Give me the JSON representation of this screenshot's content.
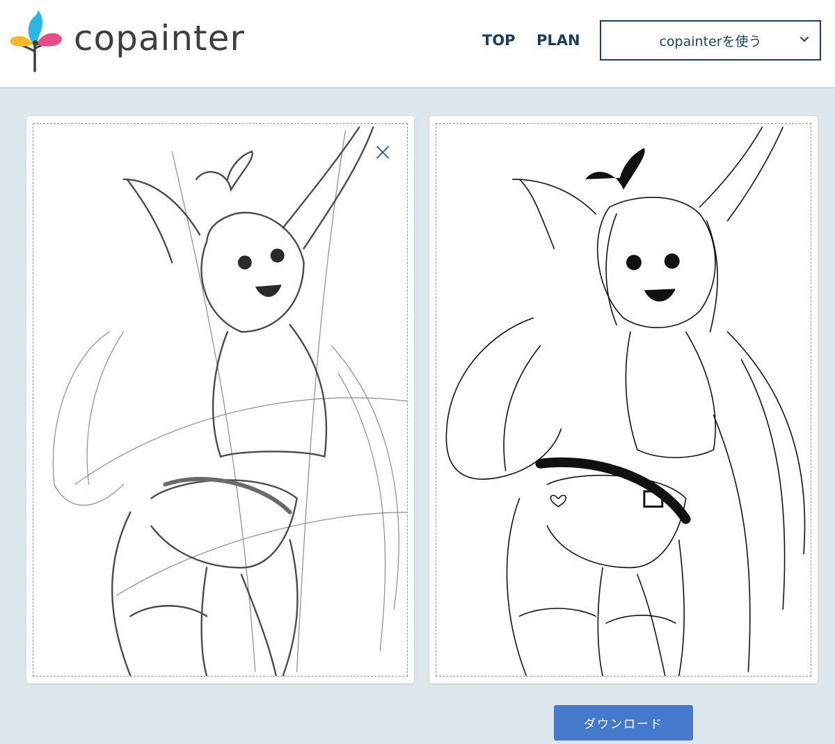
{
  "header": {
    "logo_text": "copainter",
    "nav": {
      "top_label": "TOP",
      "plan_label": "PLAN"
    },
    "menu_select": {
      "selected": "copainterを使う"
    }
  },
  "colors": {
    "navy": "#1d3d5c",
    "download_button": "#4479cc",
    "page_background": "#dde8ec",
    "logo_cyan": "#2bb5e8",
    "logo_pink": "#e84d8a",
    "logo_yellow": "#f5b62a"
  },
  "icons": {
    "logo": "flower-brush-icon",
    "select": "chevron-down-icon",
    "remove": "close-icon"
  },
  "panels": {
    "input": {
      "content": "rough pencil sketch of anime girl with arms raised"
    },
    "output": {
      "content": "clean line art of anime girl with arms raised"
    }
  },
  "download": {
    "label": "ダウンロード"
  }
}
